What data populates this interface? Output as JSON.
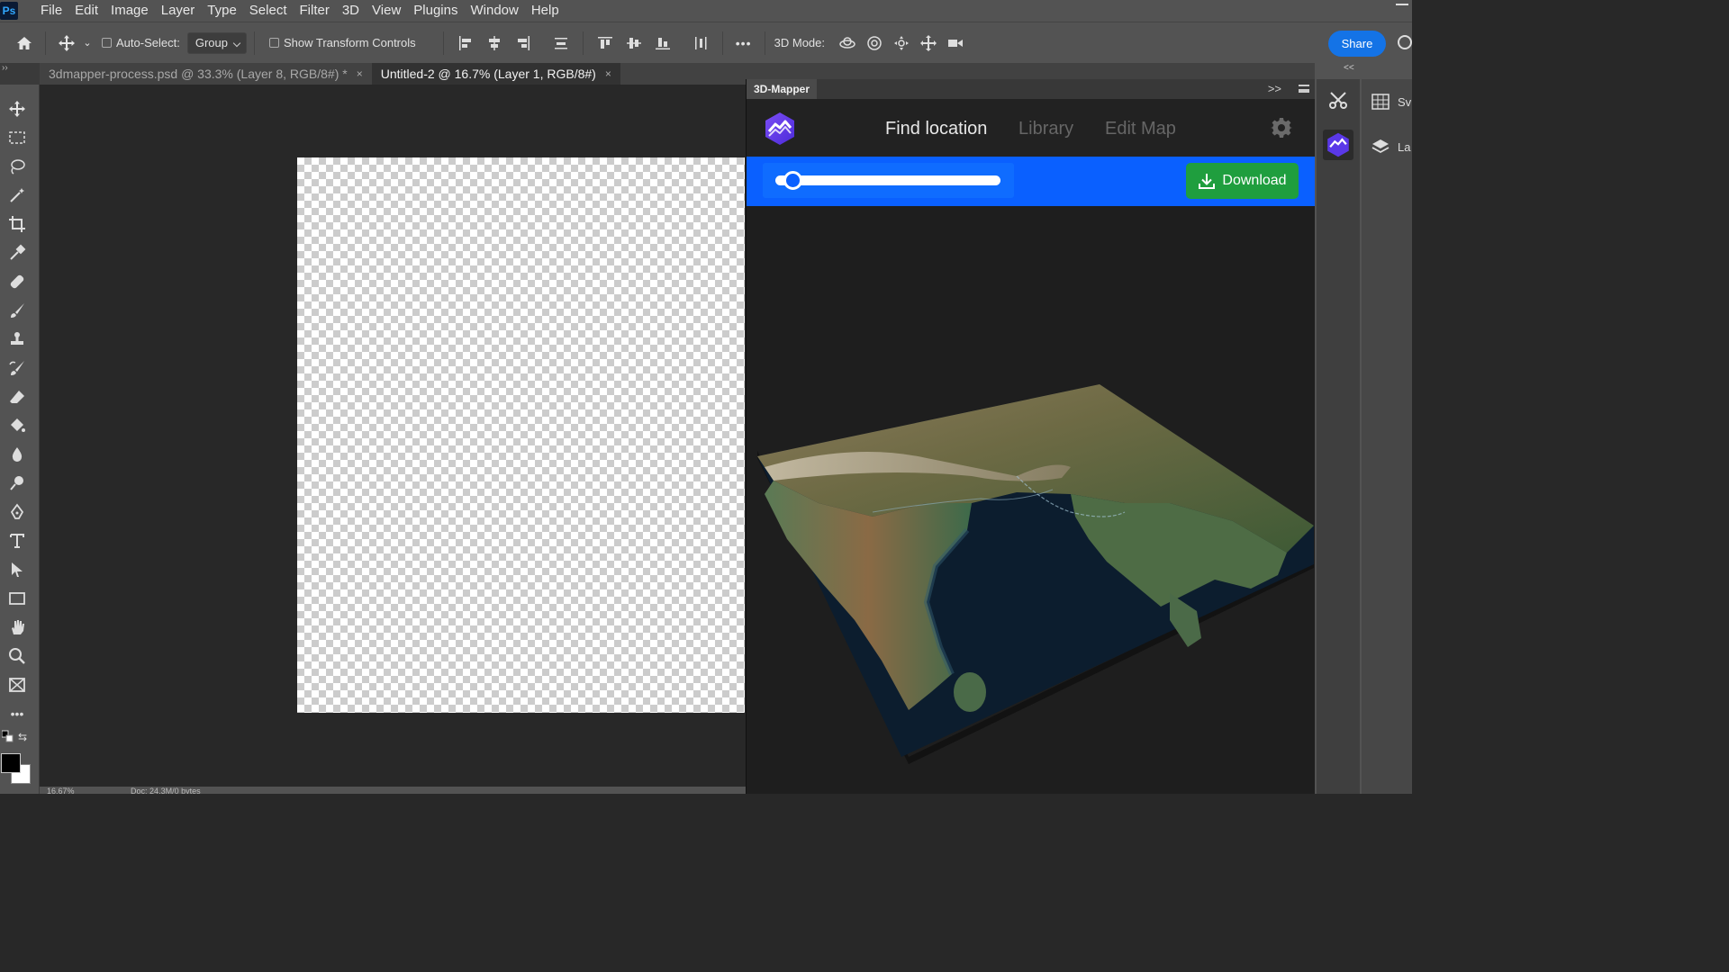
{
  "app": {
    "logo_text": "Ps",
    "menu": [
      "File",
      "Edit",
      "Image",
      "Layer",
      "Type",
      "Select",
      "Filter",
      "3D",
      "View",
      "Plugins",
      "Window",
      "Help"
    ]
  },
  "options_bar": {
    "auto_select_label": "Auto-Select:",
    "auto_select_value": "Group",
    "show_transform_label": "Show Transform Controls",
    "three_d_mode_label": "3D Mode:",
    "more_label": "•••",
    "share_label": "Share"
  },
  "tabs": [
    {
      "label": "3dmapper-process.psd @ 33.3% (Layer 8, RGB/8#) *",
      "close": "×"
    },
    {
      "label": "Untitled-2 @ 16.7% (Layer 1, RGB/8#)",
      "close": "×"
    }
  ],
  "status": {
    "zoom": "16.67%",
    "doc": "Doc: 24.3M/0 bytes"
  },
  "plugin": {
    "title": "3D-Mapper",
    "expand": ">>",
    "nav": [
      "Find location",
      "Library",
      "Edit Map"
    ],
    "download_label": "Download",
    "slider_value": 0.05,
    "colors": {
      "blue_bar": "#0a60ff",
      "download": "#1f9e3e",
      "logo": "#6a3cf0"
    }
  },
  "right_panels": {
    "collapse": "<<",
    "items": [
      {
        "label": "Sv",
        "icon": "grid-icon"
      },
      {
        "label": "La",
        "icon": "layers-icon"
      }
    ]
  },
  "toolbox": {
    "more": "•••"
  }
}
